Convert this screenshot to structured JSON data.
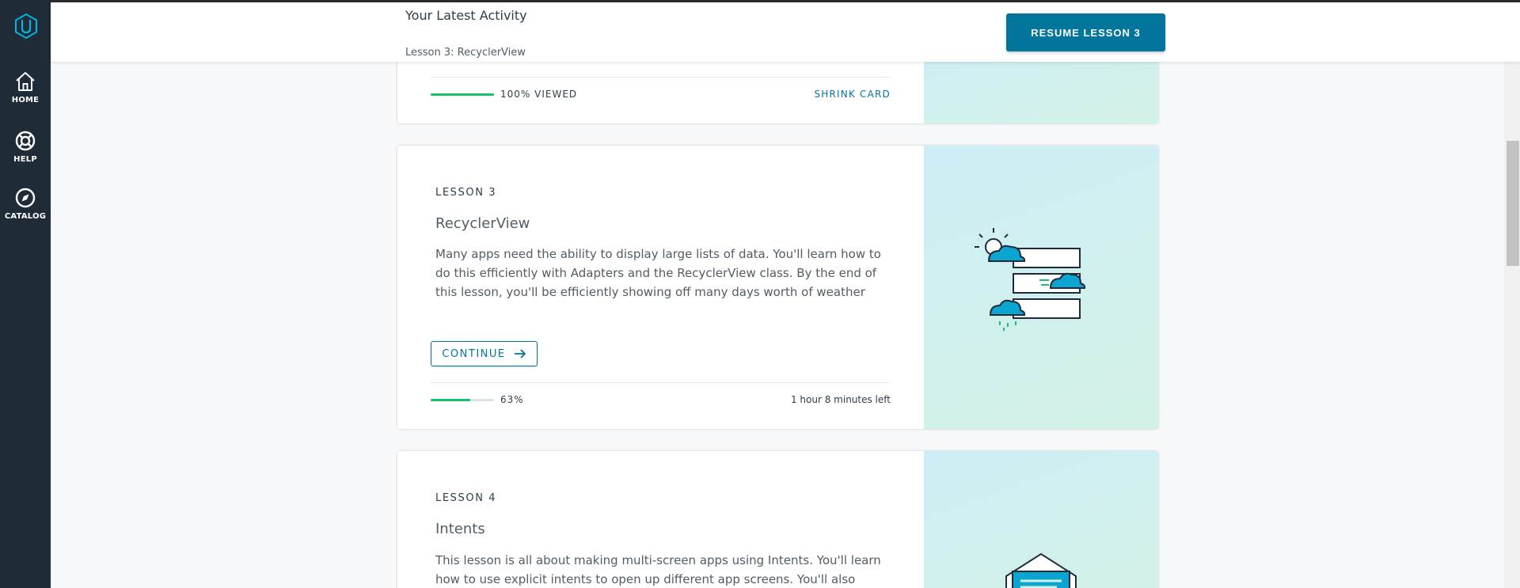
{
  "sidebar": {
    "logo": "udacity-logo-icon",
    "items": [
      {
        "label": "HOME",
        "icon": "home-icon"
      },
      {
        "label": "HELP",
        "icon": "lifebuoy-icon"
      },
      {
        "label": "CATALOG",
        "icon": "compass-icon"
      }
    ]
  },
  "header": {
    "title": "Your Latest Activity",
    "subtitle": "Lesson 3: RecyclerView",
    "resume_label": "RESUME LESSON 3"
  },
  "lessons": [
    {
      "progress_label": "100% VIEWED",
      "progress": 1.0,
      "action_label": "SHRINK CARD"
    },
    {
      "number": "LESSON 3",
      "title": "RecyclerView",
      "description": "Many apps need the ability to display large lists of data. You'll learn how to do this efficiently with Adapters and the RecyclerView class. By the end of this lesson, you'll be efficiently showing off many days worth of weather",
      "continue_label": "CONTINUE",
      "progress_label": "63%",
      "progress": 0.63,
      "time_left": "1 hour 8 minutes left",
      "illustration": "weather-list-illustration"
    },
    {
      "number": "LESSON 4",
      "title": "Intents",
      "description": "This lesson is all about making multi-screen apps using Intents. You'll learn how to use explicit intents to open up different app screens. You'll also",
      "illustration": "envelope-illustration"
    }
  ],
  "colors": {
    "accent": "#02769a",
    "progress": "#15c26b",
    "sidebar": "#1f2b36"
  }
}
